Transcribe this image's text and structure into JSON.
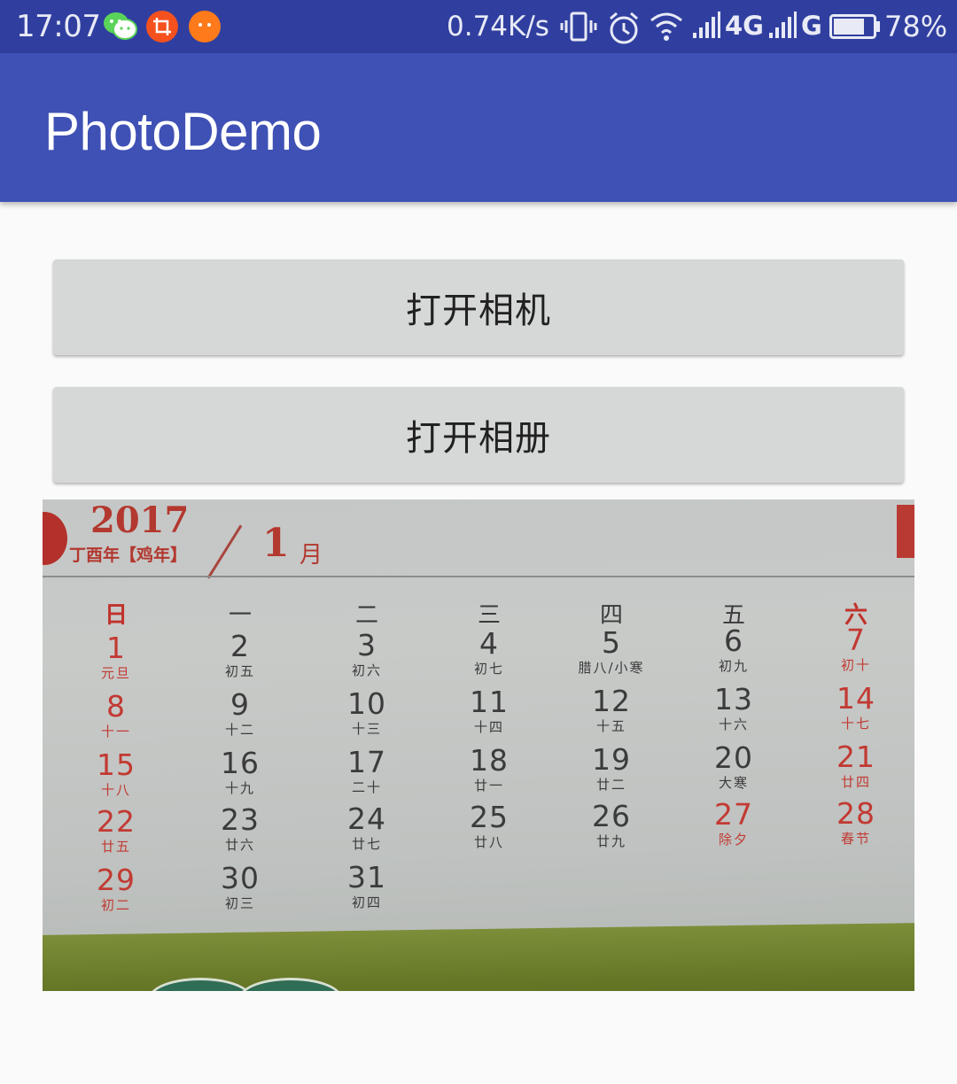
{
  "status_bar": {
    "time": "17:07",
    "notifications": [
      "wechat-icon",
      "crop-app-icon",
      "chat-app-icon"
    ],
    "net_speed": "0.74K/s",
    "network1": "4G",
    "network2": "G",
    "battery_level": 0.78,
    "battery_percent": "78%"
  },
  "app_bar": {
    "title": "PhotoDemo"
  },
  "buttons": {
    "open_camera": "打开相机",
    "open_album": "打开相册"
  },
  "photo": {
    "calendar": {
      "year": "2017",
      "year_sub": "丁酉年【鸡年】",
      "month": "1",
      "month_unit": "月",
      "weekdays": [
        "日",
        "一",
        "二",
        "三",
        "四",
        "五",
        "六"
      ],
      "rows": [
        [
          {
            "num": "1",
            "lunar": "元旦"
          },
          {
            "num": "2",
            "lunar": "初五"
          },
          {
            "num": "3",
            "lunar": "初六"
          },
          {
            "num": "4",
            "lunar": "初七"
          },
          {
            "num": "5",
            "lunar": "腊八/小寒"
          },
          {
            "num": "6",
            "lunar": "初九"
          },
          {
            "num": "7",
            "lunar": "初十"
          }
        ],
        [
          {
            "num": "8",
            "lunar": "十一"
          },
          {
            "num": "9",
            "lunar": "十二"
          },
          {
            "num": "10",
            "lunar": "十三"
          },
          {
            "num": "11",
            "lunar": "十四"
          },
          {
            "num": "12",
            "lunar": "十五"
          },
          {
            "num": "13",
            "lunar": "十六"
          },
          {
            "num": "14",
            "lunar": "十七"
          }
        ],
        [
          {
            "num": "15",
            "lunar": "十八"
          },
          {
            "num": "16",
            "lunar": "十九"
          },
          {
            "num": "17",
            "lunar": "二十"
          },
          {
            "num": "18",
            "lunar": "廿一"
          },
          {
            "num": "19",
            "lunar": "廿二"
          },
          {
            "num": "20",
            "lunar": "大寒"
          },
          {
            "num": "21",
            "lunar": "廿四"
          }
        ],
        [
          {
            "num": "22",
            "lunar": "廿五"
          },
          {
            "num": "23",
            "lunar": "廿六"
          },
          {
            "num": "24",
            "lunar": "廿七"
          },
          {
            "num": "25",
            "lunar": "廿八"
          },
          {
            "num": "26",
            "lunar": "廿九"
          },
          {
            "num": "27",
            "lunar": "除夕"
          },
          {
            "num": "28",
            "lunar": "春节"
          }
        ],
        [
          {
            "num": "29",
            "lunar": "初二"
          },
          {
            "num": "30",
            "lunar": "初三"
          },
          {
            "num": "31",
            "lunar": "初四"
          }
        ]
      ]
    }
  },
  "colors": {
    "status_bar": "#303f9f",
    "app_bar": "#3f51b5",
    "button": "#d6d7d7",
    "calendar_red": "#c23a33"
  }
}
